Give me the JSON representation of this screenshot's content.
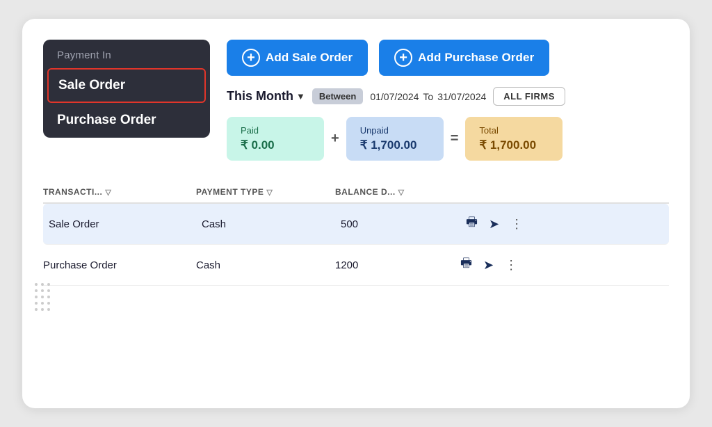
{
  "sidebar": {
    "header": "Payment In",
    "items": [
      {
        "id": "sale-order",
        "label": "Sale Order",
        "active": true
      },
      {
        "id": "purchase-order",
        "label": "Purchase Order",
        "active": false
      }
    ]
  },
  "buttons": {
    "add_sale_order": "Add Sale Order",
    "add_purchase_order": "Add Purchase Order"
  },
  "filter": {
    "month_label": "This Month",
    "between_label": "Between",
    "date_from": "01/07/2024",
    "date_to_label": "To",
    "date_to": "31/07/2024",
    "all_firms_label": "ALL FIRMS"
  },
  "summary": {
    "paid_label": "Paid",
    "paid_amount": "₹ 0.00",
    "unpaid_label": "Unpaid",
    "unpaid_amount": "₹ 1,700.00",
    "total_label": "Total",
    "total_amount": "₹ 1,700.00",
    "plus_sep": "+",
    "eq_sep": "="
  },
  "table": {
    "columns": [
      {
        "id": "transaction",
        "label": "TRANSACTI...",
        "filter": true
      },
      {
        "id": "payment_type",
        "label": "PAYMENT TYPE",
        "filter": true
      },
      {
        "id": "balance_d",
        "label": "BALANCE D...",
        "filter": true
      }
    ],
    "rows": [
      {
        "id": 1,
        "transaction": "Sale Order",
        "payment_type": "Cash",
        "balance": "500",
        "highlighted": true
      },
      {
        "id": 2,
        "transaction": "Purchase Order",
        "payment_type": "Cash",
        "balance": "1200",
        "highlighted": false
      }
    ]
  }
}
